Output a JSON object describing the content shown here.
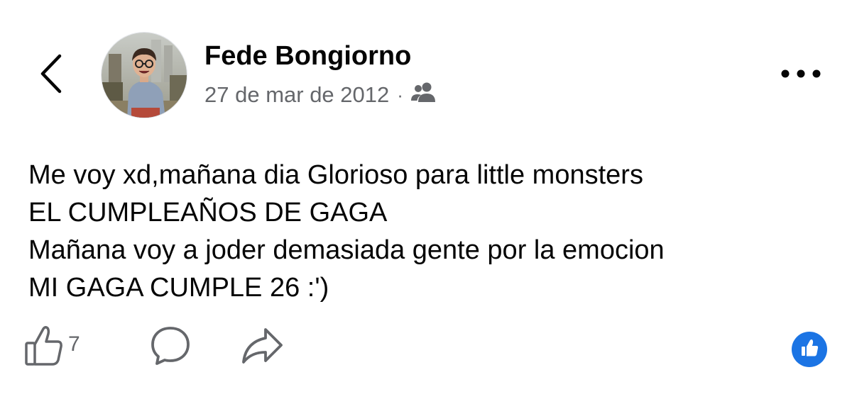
{
  "post": {
    "author": "Fede Bongiorno",
    "date": "27 de mar de 2012",
    "separator": "·",
    "audience_icon": "friends-icon",
    "lines": [
      "Me voy xd,mañana dia Glorioso para little monsters",
      "EL CUMPLEAÑOS DE GAGA",
      "Mañana voy a joder demasiada gente por la emocion",
      "MI GAGA CUMPLE 26 :')"
    ]
  },
  "actions": {
    "like_count": "7",
    "like_icon": "thumbs-up-outline-icon",
    "comment_icon": "comment-bubble-icon",
    "share_icon": "share-arrow-icon"
  },
  "nav": {
    "back_icon": "chevron-left-icon",
    "more_icon": "more-dots-icon"
  },
  "colors": {
    "text": "#050505",
    "secondary_text": "#65676b",
    "accent": "#1b74e4",
    "background": "#ffffff"
  }
}
